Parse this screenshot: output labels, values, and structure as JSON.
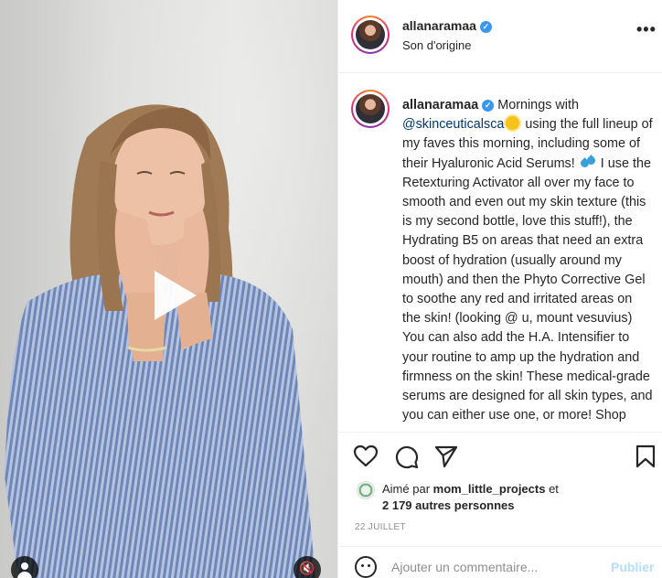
{
  "post": {
    "username": "allanaramaa",
    "verified_mark": "✓",
    "audio_label": "Son d'origine",
    "more_label": "•••"
  },
  "caption": {
    "username": "allanaramaa",
    "verified_mark": "✓",
    "text_1": " Mornings with ",
    "mention": "@skinceuticalsca",
    "emoji_1": "sun-emoji",
    "text_2": " using the full lineup of my faves this morning, including some of their Hyaluronic Acid Serums! ",
    "emoji_2": "droplets-emoji",
    "text_3": " I use the Retexturing Activator all over my face to smooth and even out my skin texture (this is my second bottle, love this stuff!), the Hydrating B5 on areas that need an extra boost of hydration (usually around my mouth) and then the Phyto Corrective Gel to soothe any red and irritated areas on the skin! (looking @ u, mount vesuvius) You can also add the H.A. Intensifier to your routine to amp up the hydration and firmness on the skin! These medical-grade serums are designed for all skin types, and you can either use one, or more! Shop"
  },
  "actions": {
    "like_icon": "heart-icon",
    "comment_icon": "comment-icon",
    "share_icon": "paper-plane-icon",
    "save_icon": "bookmark-icon"
  },
  "likes": {
    "prefix": "Aimé par ",
    "liker": "mom_little_projects",
    "suffix": " et",
    "others": "2 179 autres personnes"
  },
  "date": "22 JUILLET",
  "comment": {
    "placeholder": "Ajouter un commentaire...",
    "publish_label": "Publier"
  },
  "media": {
    "play_icon": "play-icon",
    "user_tag_icon": "user-icon",
    "mute_icon": "speaker-muted-icon",
    "mute_glyph": "🔇"
  },
  "colors": {
    "link": "#00376b",
    "verified": "#3897f0",
    "publish_disabled": "#b2dffc",
    "secondary_text": "#8e8e8e"
  }
}
